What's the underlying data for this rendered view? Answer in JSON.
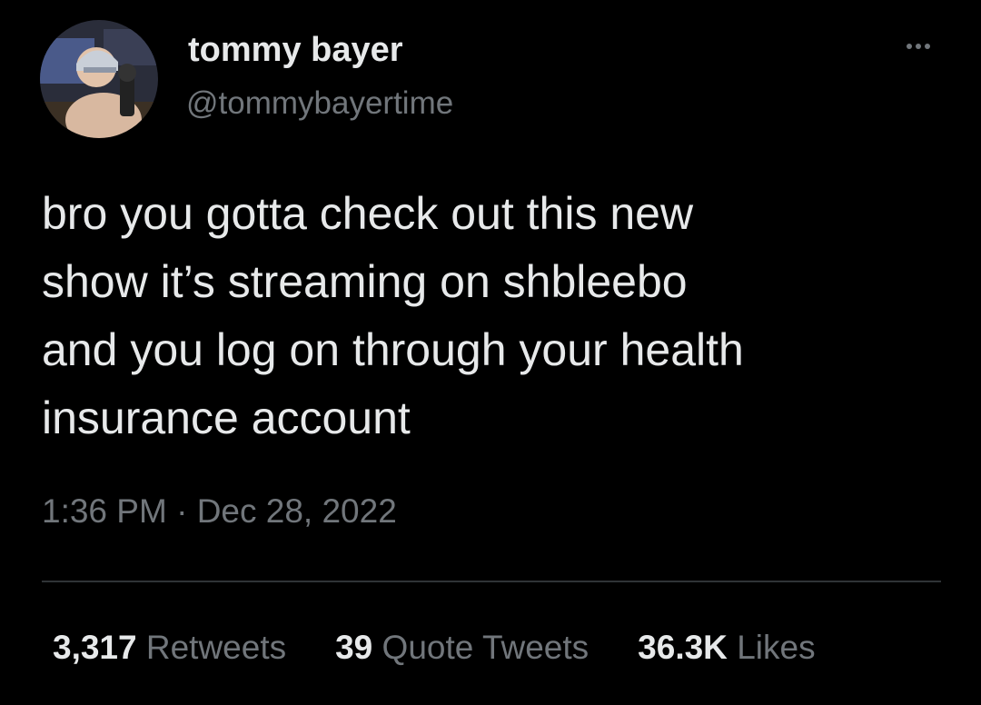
{
  "author": {
    "name": "tommy bayer",
    "handle": "@tommybayertime"
  },
  "tweet": {
    "lines": [
      "bro you gotta check out this new",
      "show it’s streaming on shbleebo",
      "and you log on through your health",
      "insurance account"
    ],
    "time": "1:36 PM",
    "separator": "·",
    "date": "Dec 28, 2022"
  },
  "stats": {
    "retweets_count": "3,317",
    "retweets_label": "Retweets",
    "quotes_count": "39",
    "quotes_label": "Quote Tweets",
    "likes_count": "36.3K",
    "likes_label": "Likes"
  },
  "icons": {
    "more": "more-horizontal-icon"
  },
  "colors": {
    "background": "#000000",
    "primary_text": "#e7e9ea",
    "secondary_text": "#71767b",
    "divider": "#2f3336"
  }
}
